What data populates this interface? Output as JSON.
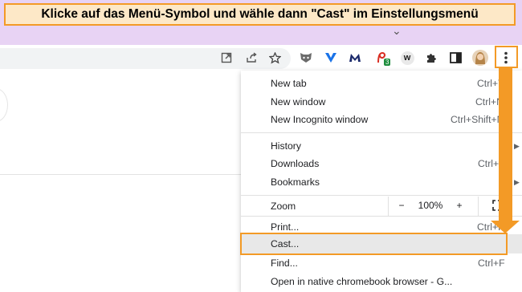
{
  "banner": {
    "text": "Klicke auf das Menü-Symbol und wähle dann \"Cast\" im Einstellungsmenü"
  },
  "colors": {
    "accent": "#f39a26",
    "tabstrip": "#e8d3f4",
    "banner_bg": "#fde8c7"
  },
  "toolbar": {
    "icons": [
      "open-in-app-icon",
      "share-icon",
      "bookmark-star-icon",
      "ext-fox-icon",
      "ext-vpn-icon",
      "ext-m-icon",
      "ext-pdf-icon",
      "ext-w-icon",
      "extensions-puzzle-icon",
      "side-panel-icon",
      "profile-avatar",
      "kebab-menu-icon"
    ],
    "ext_badge": "3",
    "ext_w_label": "w"
  },
  "menu": {
    "new_tab": {
      "label": "New tab",
      "shortcut": "Ctrl+T"
    },
    "new_window": {
      "label": "New window",
      "shortcut": "Ctrl+N"
    },
    "new_incognito": {
      "label": "New Incognito window",
      "shortcut": "Ctrl+Shift+N"
    },
    "history": {
      "label": "History"
    },
    "downloads": {
      "label": "Downloads",
      "shortcut": "Ctrl+J"
    },
    "bookmarks": {
      "label": "Bookmarks"
    },
    "zoom": {
      "label": "Zoom",
      "minus": "−",
      "value": "100%",
      "plus": "+"
    },
    "print": {
      "label": "Print...",
      "shortcut": "Ctrl+P"
    },
    "cast": {
      "label": "Cast..."
    },
    "find": {
      "label": "Find...",
      "shortcut": "Ctrl+F"
    },
    "open_native": {
      "label": "Open in native chromebook browser - G..."
    }
  }
}
